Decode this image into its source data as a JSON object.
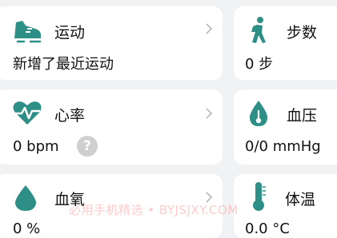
{
  "colors": {
    "accent": "#2e8f86",
    "background": "#f1f2f4",
    "card": "#ffffff",
    "watermark": "#ff8c8c"
  },
  "cards": [
    {
      "title": "运动",
      "value": "新增了最近运动",
      "icon": "running-shoe-icon"
    },
    {
      "title": "步数",
      "value": "0 步",
      "icon": "walking-person-icon"
    },
    {
      "title": "心率",
      "value": "0 bpm",
      "icon": "heart-pulse-icon",
      "help": "?"
    },
    {
      "title": "血压",
      "value": "0/0 mmHg",
      "icon": "blood-drop-icon"
    },
    {
      "title": "血氧",
      "value": "0 %",
      "icon": "droplet-icon"
    },
    {
      "title": "体温",
      "value": "0.0 °C",
      "icon": "thermometer-icon"
    }
  ],
  "watermark": "必用手机精选 • BYJSJXY.COM"
}
